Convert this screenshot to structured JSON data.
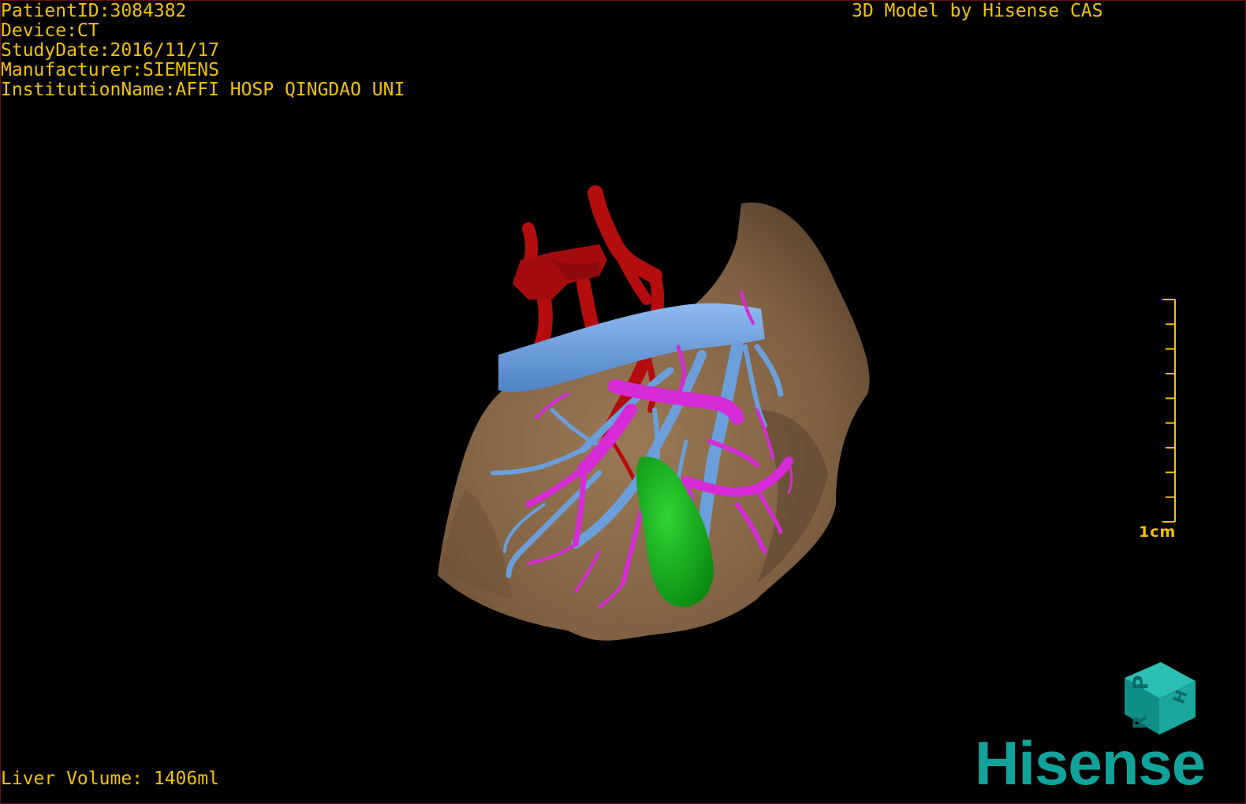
{
  "patient_info": {
    "patient_id": "PatientID:3084382",
    "device": "Device:CT",
    "study_date": "StudyDate:2016/11/17",
    "manufacturer": "Manufacturer:SIEMENS",
    "institution": "InstitutionName:AFFI HOSP QINGDAO UNI"
  },
  "credit": "3D Model by Hisense CAS",
  "liver_volume": "Liver Volume: 1406ml",
  "scale_bar": {
    "label": "1cm",
    "tick_count": 10
  },
  "orientation_cube": {
    "face_letters": [
      "P",
      "H",
      "R"
    ]
  },
  "brand": "Hisense",
  "colors": {
    "overlay_text": "#f2c200",
    "liver": "#8b6b48",
    "artery": "#b40d0d",
    "vein": "#6a9fdc",
    "portal": "#d62bd6",
    "gallbladder": "#14b31c",
    "brand": "#11a39a"
  }
}
